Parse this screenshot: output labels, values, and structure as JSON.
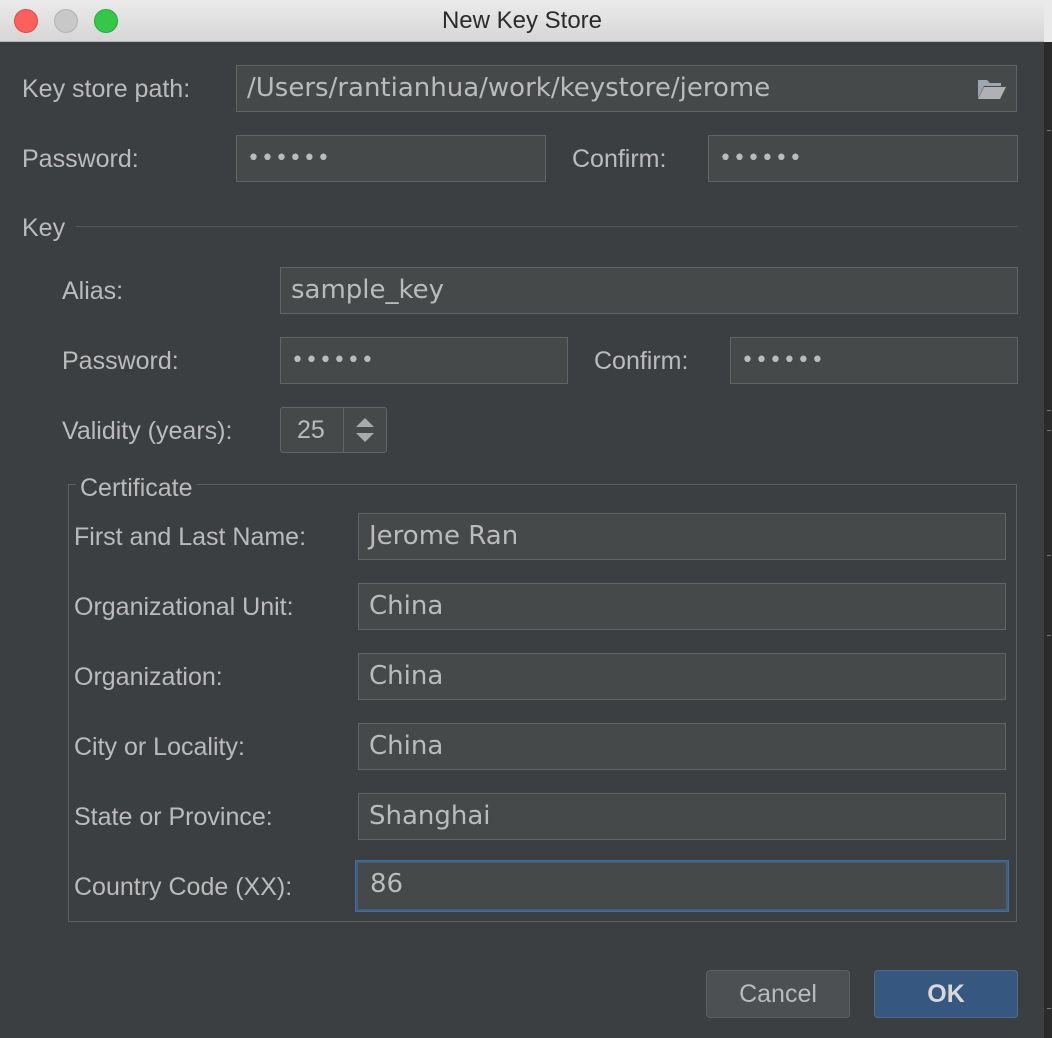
{
  "window": {
    "title": "New Key Store"
  },
  "keystore": {
    "path_label": "Key store path:",
    "path_value": "/Users/rantianhua/work/keystore/jerome",
    "password_label": "Password:",
    "password_value": "••••••",
    "confirm_label": "Confirm:",
    "confirm_value": "••••••"
  },
  "key": {
    "section_label": "Key",
    "alias_label": "Alias:",
    "alias_value": "sample_key",
    "password_label": "Password:",
    "password_value": "••••••",
    "confirm_label": "Confirm:",
    "confirm_value": "••••••",
    "validity_label": "Validity (years):",
    "validity_value": "25"
  },
  "certificate": {
    "section_label": "Certificate",
    "fields": [
      {
        "label": "First and Last Name:",
        "value": "Jerome Ran"
      },
      {
        "label": "Organizational Unit:",
        "value": "China"
      },
      {
        "label": "Organization:",
        "value": "China"
      },
      {
        "label": "City or Locality:",
        "value": "China"
      },
      {
        "label": "State or Province:",
        "value": "Shanghai"
      },
      {
        "label": "Country Code (XX):",
        "value": "86"
      }
    ]
  },
  "buttons": {
    "cancel": "Cancel",
    "ok": "OK"
  },
  "colors": {
    "background": "#3c3f41",
    "field": "#45494a",
    "accent": "#365880",
    "focus": "#3d6185"
  }
}
